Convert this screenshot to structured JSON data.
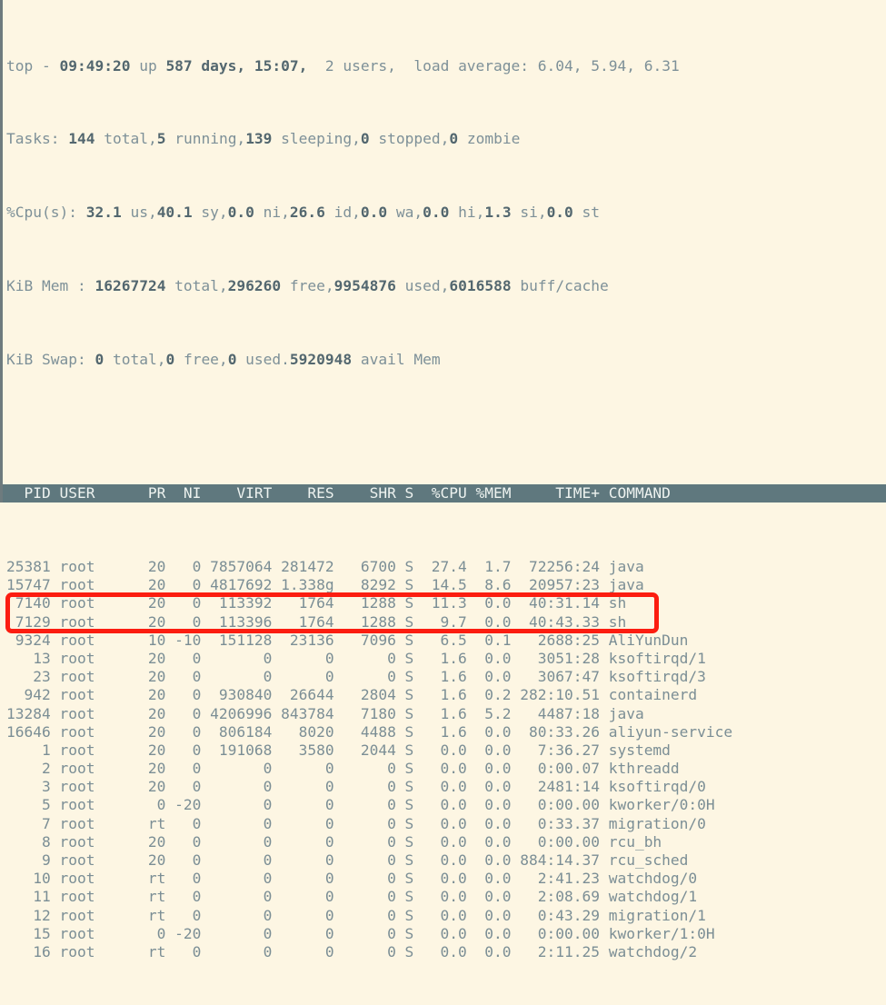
{
  "terminal": {
    "program": "top",
    "colors": {
      "background": "#fdf6e3",
      "text": "#7b8e95",
      "bold_text": "#53676f",
      "header_bar_bg": "#5f787e",
      "header_bar_text": "#eef3f0",
      "annotation": "#fc1d10"
    }
  },
  "summary": {
    "uptime_line": {
      "label": "top - ",
      "time": "09:49:20",
      "up_text": " up ",
      "uptime": "587 days, 15:07,",
      "users": "  2 users,",
      "load_label": "  load average: ",
      "load_values": "6.04, 5.94, 6.31"
    },
    "tasks_line": {
      "label": "Tasks: ",
      "total": "144",
      "total_label": " total,",
      "running": "5",
      "running_label": " running,",
      "sleeping": "139",
      "sleeping_label": " sleeping,",
      "stopped": "0",
      "stopped_label": " stopped,",
      "zombie": "0",
      "zombie_label": " zombie"
    },
    "cpu_line": {
      "label": "%Cpu(s): ",
      "us": "32.1",
      "us_label": " us,",
      "sy": "40.1",
      "sy_label": " sy,",
      "ni": "0.0",
      "ni_label": " ni,",
      "id": "26.6",
      "id_label": " id,",
      "wa": "0.0",
      "wa_label": " wa,",
      "hi": "0.0",
      "hi_label": " hi,",
      "si": "1.3",
      "si_label": " si,",
      "st": "0.0",
      "st_label": " st"
    },
    "mem_line": {
      "label": "KiB Mem : ",
      "total": "16267724",
      "total_label": " total,",
      "free": "296260",
      "free_label": " free,",
      "used": "9954876",
      "used_label": " used,",
      "buff_cache": "6016588",
      "buff_cache_label": " buff/cache"
    },
    "swap_line": {
      "label": "KiB Swap: ",
      "total": "0",
      "total_label": " total,",
      "free": "0",
      "free_label": " free,",
      "used": "0",
      "used_label": " used.",
      "avail": "5920948",
      "avail_label": " avail Mem"
    }
  },
  "table": {
    "columns": [
      "PID",
      "USER",
      "PR",
      "NI",
      "VIRT",
      "RES",
      "SHR",
      "S",
      "%CPU",
      "%MEM",
      "TIME+",
      "COMMAND"
    ],
    "header_row": "  PID USER      PR  NI    VIRT    RES    SHR S  %CPU %MEM     TIME+ COMMAND",
    "rows": [
      {
        "line": "25381 root      20   0 7857064 281472   6700 S  27.4  1.7  72256:24 java",
        "pid": "25381",
        "user": "root",
        "pr": "20",
        "ni": "0",
        "virt": "7857064",
        "res": "281472",
        "shr": "6700",
        "s": "S",
        "cpu": "27.4",
        "mem": "1.7",
        "time": "72256:24",
        "command": "java"
      },
      {
        "line": "15747 root      20   0 4817692 1.338g   8292 S  14.5  8.6  20957:23 java",
        "pid": "15747",
        "user": "root",
        "pr": "20",
        "ni": "0",
        "virt": "4817692",
        "res": "1.338g",
        "shr": "8292",
        "s": "S",
        "cpu": "14.5",
        "mem": "8.6",
        "time": "20957:23",
        "command": "java"
      },
      {
        "line": " 7140 root      20   0  113392   1764   1288 S  11.3  0.0  40:31.14 sh",
        "pid": "7140",
        "user": "root",
        "pr": "20",
        "ni": "0",
        "virt": "113392",
        "res": "1764",
        "shr": "1288",
        "s": "S",
        "cpu": "11.3",
        "mem": "0.0",
        "time": "40:31.14",
        "command": "sh",
        "highlighted": true
      },
      {
        "line": " 7129 root      20   0  113396   1764   1288 S   9.7  0.0  40:43.33 sh",
        "pid": "7129",
        "user": "root",
        "pr": "20",
        "ni": "0",
        "virt": "113396",
        "res": "1764",
        "shr": "1288",
        "s": "S",
        "cpu": "9.7",
        "mem": "0.0",
        "time": "40:43.33",
        "command": "sh",
        "highlighted": true
      },
      {
        "line": " 9324 root      10 -10  151128  23136   7096 S   6.5  0.1   2688:25 AliYunDun",
        "pid": "9324",
        "user": "root",
        "pr": "10",
        "ni": "-10",
        "virt": "151128",
        "res": "23136",
        "shr": "7096",
        "s": "S",
        "cpu": "6.5",
        "mem": "0.1",
        "time": "2688:25",
        "command": "AliYunDun"
      },
      {
        "line": "   13 root      20   0       0      0      0 S   1.6  0.0   3051:28 ksoftirqd/1",
        "pid": "13",
        "user": "root",
        "pr": "20",
        "ni": "0",
        "virt": "0",
        "res": "0",
        "shr": "0",
        "s": "S",
        "cpu": "1.6",
        "mem": "0.0",
        "time": "3051:28",
        "command": "ksoftirqd/1"
      },
      {
        "line": "   23 root      20   0       0      0      0 S   1.6  0.0   3067:47 ksoftirqd/3",
        "pid": "23",
        "user": "root",
        "pr": "20",
        "ni": "0",
        "virt": "0",
        "res": "0",
        "shr": "0",
        "s": "S",
        "cpu": "1.6",
        "mem": "0.0",
        "time": "3067:47",
        "command": "ksoftirqd/3"
      },
      {
        "line": "  942 root      20   0  930840  26644   2804 S   1.6  0.2 282:10.51 containerd",
        "pid": "942",
        "user": "root",
        "pr": "20",
        "ni": "0",
        "virt": "930840",
        "res": "26644",
        "shr": "2804",
        "s": "S",
        "cpu": "1.6",
        "mem": "0.2",
        "time": "282:10.51",
        "command": "containerd"
      },
      {
        "line": "13284 root      20   0 4206996 843784   7180 S   1.6  5.2   4487:18 java",
        "pid": "13284",
        "user": "root",
        "pr": "20",
        "ni": "0",
        "virt": "4206996",
        "res": "843784",
        "shr": "7180",
        "s": "S",
        "cpu": "1.6",
        "mem": "5.2",
        "time": "4487:18",
        "command": "java"
      },
      {
        "line": "16646 root      20   0  806184   8020   4488 S   1.6  0.0  80:33.26 aliyun-service",
        "pid": "16646",
        "user": "root",
        "pr": "20",
        "ni": "0",
        "virt": "806184",
        "res": "8020",
        "shr": "4488",
        "s": "S",
        "cpu": "1.6",
        "mem": "0.0",
        "time": "80:33.26",
        "command": "aliyun-service"
      },
      {
        "line": "    1 root      20   0  191068   3580   2044 S   0.0  0.0   7:36.27 systemd",
        "pid": "1",
        "user": "root",
        "pr": "20",
        "ni": "0",
        "virt": "191068",
        "res": "3580",
        "shr": "2044",
        "s": "S",
        "cpu": "0.0",
        "mem": "0.0",
        "time": "7:36.27",
        "command": "systemd"
      },
      {
        "line": "    2 root      20   0       0      0      0 S   0.0  0.0   0:00.07 kthreadd",
        "pid": "2",
        "user": "root",
        "pr": "20",
        "ni": "0",
        "virt": "0",
        "res": "0",
        "shr": "0",
        "s": "S",
        "cpu": "0.0",
        "mem": "0.0",
        "time": "0:00.07",
        "command": "kthreadd"
      },
      {
        "line": "    3 root      20   0       0      0      0 S   0.0  0.0   2481:14 ksoftirqd/0",
        "pid": "3",
        "user": "root",
        "pr": "20",
        "ni": "0",
        "virt": "0",
        "res": "0",
        "shr": "0",
        "s": "S",
        "cpu": "0.0",
        "mem": "0.0",
        "time": "2481:14",
        "command": "ksoftirqd/0"
      },
      {
        "line": "    5 root       0 -20       0      0      0 S   0.0  0.0   0:00.00 kworker/0:0H",
        "pid": "5",
        "user": "root",
        "pr": "0",
        "ni": "-20",
        "virt": "0",
        "res": "0",
        "shr": "0",
        "s": "S",
        "cpu": "0.0",
        "mem": "0.0",
        "time": "0:00.00",
        "command": "kworker/0:0H"
      },
      {
        "line": "    7 root      rt   0       0      0      0 S   0.0  0.0   0:33.37 migration/0",
        "pid": "7",
        "user": "root",
        "pr": "rt",
        "ni": "0",
        "virt": "0",
        "res": "0",
        "shr": "0",
        "s": "S",
        "cpu": "0.0",
        "mem": "0.0",
        "time": "0:33.37",
        "command": "migration/0"
      },
      {
        "line": "    8 root      20   0       0      0      0 S   0.0  0.0   0:00.00 rcu_bh",
        "pid": "8",
        "user": "root",
        "pr": "20",
        "ni": "0",
        "virt": "0",
        "res": "0",
        "shr": "0",
        "s": "S",
        "cpu": "0.0",
        "mem": "0.0",
        "time": "0:00.00",
        "command": "rcu_bh"
      },
      {
        "line": "    9 root      20   0       0      0      0 S   0.0  0.0 884:14.37 rcu_sched",
        "pid": "9",
        "user": "root",
        "pr": "20",
        "ni": "0",
        "virt": "0",
        "res": "0",
        "shr": "0",
        "s": "S",
        "cpu": "0.0",
        "mem": "0.0",
        "time": "884:14.37",
        "command": "rcu_sched"
      },
      {
        "line": "   10 root      rt   0       0      0      0 S   0.0  0.0   2:41.23 watchdog/0",
        "pid": "10",
        "user": "root",
        "pr": "rt",
        "ni": "0",
        "virt": "0",
        "res": "0",
        "shr": "0",
        "s": "S",
        "cpu": "0.0",
        "mem": "0.0",
        "time": "2:41.23",
        "command": "watchdog/0"
      },
      {
        "line": "   11 root      rt   0       0      0      0 S   0.0  0.0   2:08.69 watchdog/1",
        "pid": "11",
        "user": "root",
        "pr": "rt",
        "ni": "0",
        "virt": "0",
        "res": "0",
        "shr": "0",
        "s": "S",
        "cpu": "0.0",
        "mem": "0.0",
        "time": "2:08.69",
        "command": "watchdog/1"
      },
      {
        "line": "   12 root      rt   0       0      0      0 S   0.0  0.0   0:43.29 migration/1",
        "pid": "12",
        "user": "root",
        "pr": "rt",
        "ni": "0",
        "virt": "0",
        "res": "0",
        "shr": "0",
        "s": "S",
        "cpu": "0.0",
        "mem": "0.0",
        "time": "0:43.29",
        "command": "migration/1"
      },
      {
        "line": "   15 root       0 -20       0      0      0 S   0.0  0.0   0:00.00 kworker/1:0H",
        "pid": "15",
        "user": "root",
        "pr": "0",
        "ni": "-20",
        "virt": "0",
        "res": "0",
        "shr": "0",
        "s": "S",
        "cpu": "0.0",
        "mem": "0.0",
        "time": "0:00.00",
        "command": "kworker/1:0H"
      },
      {
        "line": "   16 root      rt   0       0      0      0 S   0.0  0.0   2:11.25 watchdog/2",
        "pid": "16",
        "user": "root",
        "pr": "rt",
        "ni": "0",
        "virt": "0",
        "res": "0",
        "shr": "0",
        "s": "S",
        "cpu": "0.0",
        "mem": "0.0",
        "time": "2:11.25",
        "command": "watchdog/2"
      }
    ]
  },
  "annotation": {
    "type": "rectangle-highlight",
    "color": "#fc1d10",
    "targets": [
      "7140",
      "7129"
    ]
  }
}
